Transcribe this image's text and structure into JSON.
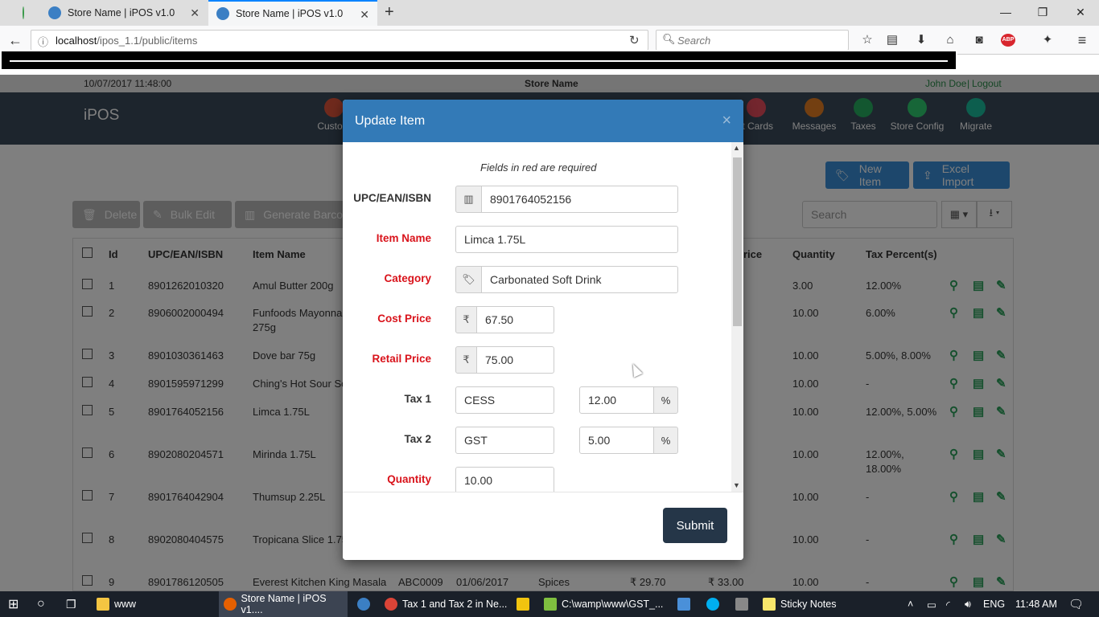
{
  "browser": {
    "tabs": [
      {
        "label": ""
      },
      {
        "label": "Store Name | iPOS v1.0"
      },
      {
        "label": "Store Name | iPOS v1.0"
      }
    ],
    "url_host": "localhost",
    "url_path": "/ipos_1.1/public/items",
    "search_placeholder": "Search"
  },
  "app": {
    "datetime": "10/07/2017 11:48:00",
    "store_name": "Store Name",
    "user": "John Doe",
    "separator": "|",
    "logout": "Logout",
    "brand": "iPOS",
    "nav": [
      {
        "label": "Custom",
        "color": "#e0543a"
      },
      {
        "label": "ft Cards",
        "color": "#e74c5c"
      },
      {
        "label": "Messages",
        "color": "#e67e22"
      },
      {
        "label": "Taxes",
        "color": "#27ae60"
      },
      {
        "label": "Store Config",
        "color": "#2ecc71"
      },
      {
        "label": "Migrate",
        "color": "#1abc9c"
      }
    ],
    "buttons": {
      "new_item": "New Item",
      "excel_import": "Excel Import",
      "delete": "Delete",
      "bulk_edit": "Bulk Edit",
      "generate_barcodes": "Generate Barcodes"
    },
    "table_search_placeholder": "Search",
    "columns": {
      "id": "Id",
      "upc": "UPC/EAN/ISBN",
      "item_name": "Item Name",
      "price": "rice",
      "quantity": "Quantity",
      "tax": "Tax Percent(s)"
    },
    "rows": [
      {
        "id": "1",
        "upc": "8901262010320",
        "name": "Amul Butter 200g",
        "qty": "3.00",
        "tax": "12.00%"
      },
      {
        "id": "2",
        "upc": "8906002000494",
        "name": "Funfoods Mayonnai",
        "name2": "275g",
        "qty": "10.00",
        "tax": "6.00%"
      },
      {
        "id": "3",
        "upc": "8901030361463",
        "name": "Dove bar 75g",
        "qty": "10.00",
        "tax": "5.00%, 8.00%"
      },
      {
        "id": "4",
        "upc": "8901595971299",
        "name": "Ching's Hot Sour So",
        "qty": "10.00",
        "tax": "-"
      },
      {
        "id": "5",
        "upc": "8901764052156",
        "name": "Limca 1.75L",
        "qty": "10.00",
        "tax": "12.00%, 5.00%"
      },
      {
        "id": "6",
        "upc": "8902080204571",
        "name": "Mirinda 1.75L",
        "qty": "10.00",
        "tax": "12.00%,",
        "tax2": "18.00%"
      },
      {
        "id": "7",
        "upc": "8901764042904",
        "name": "Thumsup 2.25L",
        "qty": "10.00",
        "tax": "-"
      },
      {
        "id": "8",
        "upc": "8902080404575",
        "name": "Tropicana Slice 1.75",
        "qty": "10.00",
        "tax": "-"
      },
      {
        "id": "9",
        "upc": "8901786120505",
        "name": "Everest Kitchen King Masala",
        "code": "ABC0009",
        "date": "01/06/2017",
        "cat": "Spices",
        "cost": "₹ 29.70",
        "retail": "₹ 33.00",
        "qty": "10.00",
        "tax": "-"
      }
    ]
  },
  "modal": {
    "title": "Update Item",
    "close": "×",
    "required_note": "Fields in red are required",
    "upc_label": "UPC/EAN/ISBN",
    "upc_value": "8901764052156",
    "item_name_label": "Item Name",
    "item_name_value": "Limca 1.75L",
    "category_label": "Category",
    "category_value": "Carbonated Soft Drink",
    "cost_label": "Cost Price",
    "cost_value": "67.50",
    "retail_label": "Retail Price",
    "retail_value": "75.00",
    "currency": "₹",
    "tax1_label": "Tax 1",
    "tax1_name": "CESS",
    "tax1_value": "12.00",
    "tax2_label": "Tax 2",
    "tax2_name": "GST",
    "tax2_value": "5.00",
    "percent": "%",
    "quantity_label": "Quantity",
    "quantity_value": "10.00",
    "submit": "Submit"
  },
  "taskbar": {
    "items": [
      {
        "label": "www"
      },
      {
        "label": "Store Name | iPOS v1...."
      },
      {
        "label": "Tax 1 and Tax 2 in Ne..."
      },
      {
        "label": "C:\\wamp\\www\\GST_..."
      },
      {
        "label": "Sticky Notes"
      }
    ],
    "lang": "ENG",
    "time": "11:48 AM"
  }
}
